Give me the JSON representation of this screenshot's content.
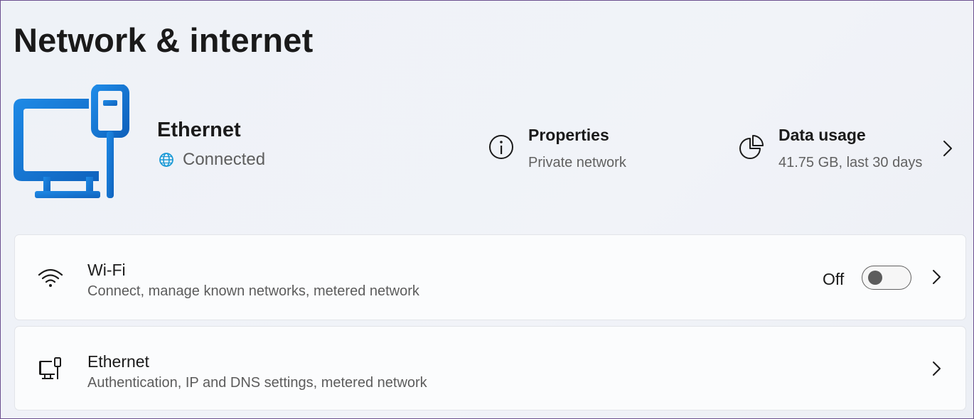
{
  "page": {
    "title": "Network & internet"
  },
  "connection": {
    "name": "Ethernet",
    "status": "Connected",
    "properties": {
      "title": "Properties",
      "subtitle": "Private network"
    },
    "data_usage": {
      "title": "Data usage",
      "subtitle": "41.75 GB, last 30 days"
    }
  },
  "settings": {
    "wifi": {
      "title": "Wi-Fi",
      "subtitle": "Connect, manage known networks, metered network",
      "toggle_label": "Off",
      "toggle_state": "off"
    },
    "ethernet": {
      "title": "Ethernet",
      "subtitle": "Authentication, IP and DNS settings, metered network"
    }
  },
  "icons": {
    "hero": "ethernet-monitor-icon",
    "status": "globe-icon",
    "properties": "info-icon",
    "data_usage": "pie-chart-icon",
    "wifi": "wifi-icon",
    "ethernet": "ethernet-icon",
    "chevron": "chevron-right-icon"
  },
  "colors": {
    "accent": "#1a7bd6",
    "accent_dark": "#0f5fb8",
    "text": "#1b1b1b",
    "subtext": "#5e5e5e"
  }
}
